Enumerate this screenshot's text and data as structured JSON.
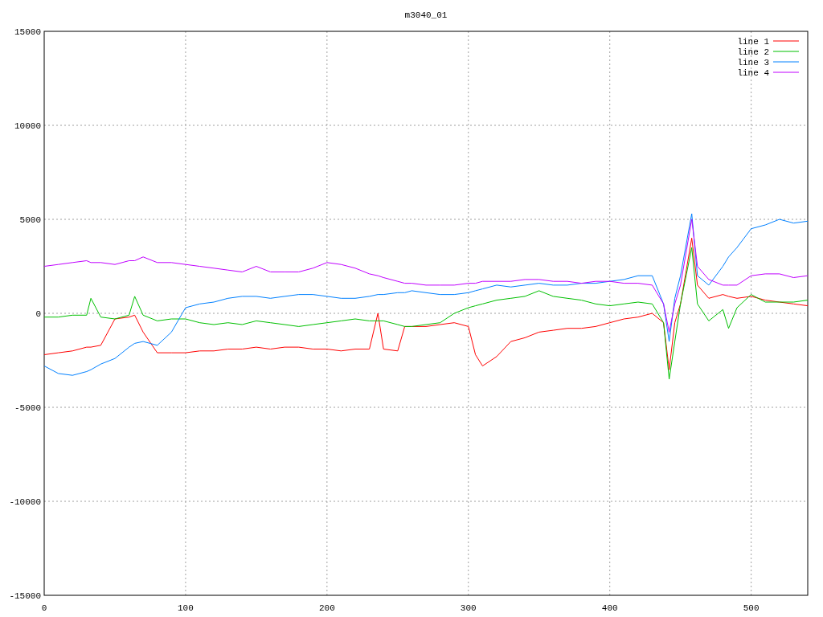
{
  "chart_data": {
    "type": "line",
    "title": "m3040_01",
    "grid": true,
    "legend": true,
    "xlim": [
      0,
      540
    ],
    "ylim": [
      -15000,
      15000
    ],
    "xticks": [
      0,
      100,
      200,
      300,
      400,
      500
    ],
    "yticks": [
      -15000,
      -10000,
      -5000,
      0,
      5000,
      10000,
      15000
    ],
    "x": [
      0,
      10,
      20,
      30,
      33,
      40,
      50,
      60,
      64,
      70,
      80,
      90,
      100,
      110,
      120,
      130,
      140,
      150,
      160,
      170,
      180,
      190,
      200,
      210,
      220,
      230,
      236,
      240,
      250,
      255,
      260,
      270,
      280,
      290,
      300,
      305,
      310,
      320,
      330,
      340,
      350,
      360,
      370,
      380,
      390,
      400,
      410,
      420,
      430,
      438,
      442,
      446,
      450,
      458,
      462,
      470,
      480,
      484,
      490,
      500,
      510,
      520,
      530,
      540
    ],
    "series": [
      {
        "name": "line 1",
        "color": "#ff0000",
        "values": [
          -2200,
          -2100,
          -2000,
          -1800,
          -1800,
          -1700,
          -300,
          -200,
          -100,
          -1000,
          -2100,
          -2100,
          -2100,
          -2000,
          -2000,
          -1900,
          -1900,
          -1800,
          -1900,
          -1800,
          -1800,
          -1900,
          -1900,
          -2000,
          -1900,
          -1900,
          0,
          -1900,
          -2000,
          -700,
          -700,
          -700,
          -600,
          -500,
          -700,
          -2200,
          -2800,
          -2300,
          -1500,
          -1300,
          -1000,
          -900,
          -800,
          -800,
          -700,
          -500,
          -300,
          -200,
          0,
          -500,
          -3000,
          -500,
          500,
          4000,
          1500,
          800,
          1000,
          900,
          800,
          900,
          700,
          600,
          500,
          400
        ]
      },
      {
        "name": "line 2",
        "color": "#00c000",
        "values": [
          -200,
          -200,
          -100,
          -100,
          800,
          -200,
          -300,
          -100,
          900,
          -100,
          -400,
          -300,
          -300,
          -500,
          -600,
          -500,
          -600,
          -400,
          -500,
          -600,
          -700,
          -600,
          -500,
          -400,
          -300,
          -400,
          -400,
          -400,
          -600,
          -700,
          -700,
          -600,
          -500,
          0,
          300,
          400,
          500,
          700,
          800,
          900,
          1200,
          900,
          800,
          700,
          500,
          400,
          500,
          600,
          500,
          -500,
          -3500,
          -1500,
          500,
          3500,
          500,
          -400,
          200,
          -800,
          300,
          1000,
          600,
          600,
          600,
          700
        ]
      },
      {
        "name": "line 3",
        "color": "#0080ff",
        "values": [
          -2800,
          -3200,
          -3300,
          -3100,
          -3000,
          -2700,
          -2400,
          -1800,
          -1600,
          -1500,
          -1700,
          -1000,
          300,
          500,
          600,
          800,
          900,
          900,
          800,
          900,
          1000,
          1000,
          900,
          800,
          800,
          900,
          1000,
          1000,
          1100,
          1100,
          1200,
          1100,
          1000,
          1000,
          1100,
          1200,
          1300,
          1500,
          1400,
          1500,
          1600,
          1500,
          1500,
          1600,
          1600,
          1700,
          1800,
          2000,
          2000,
          500,
          -1500,
          800,
          2000,
          5300,
          2000,
          1500,
          2500,
          3000,
          3500,
          4500,
          4700,
          5000,
          4800,
          4900
        ]
      },
      {
        "name": "line 4",
        "color": "#c000ff",
        "values": [
          2500,
          2600,
          2700,
          2800,
          2700,
          2700,
          2600,
          2800,
          2800,
          3000,
          2700,
          2700,
          2600,
          2500,
          2400,
          2300,
          2200,
          2500,
          2200,
          2200,
          2200,
          2400,
          2700,
          2600,
          2400,
          2100,
          2000,
          1900,
          1700,
          1600,
          1600,
          1500,
          1500,
          1500,
          1600,
          1600,
          1700,
          1700,
          1700,
          1800,
          1800,
          1700,
          1700,
          1600,
          1700,
          1700,
          1600,
          1600,
          1500,
          500,
          -1000,
          500,
          1500,
          5000,
          2500,
          1800,
          1500,
          1500,
          1500,
          2000,
          2100,
          2100,
          1900,
          2000
        ]
      }
    ]
  }
}
